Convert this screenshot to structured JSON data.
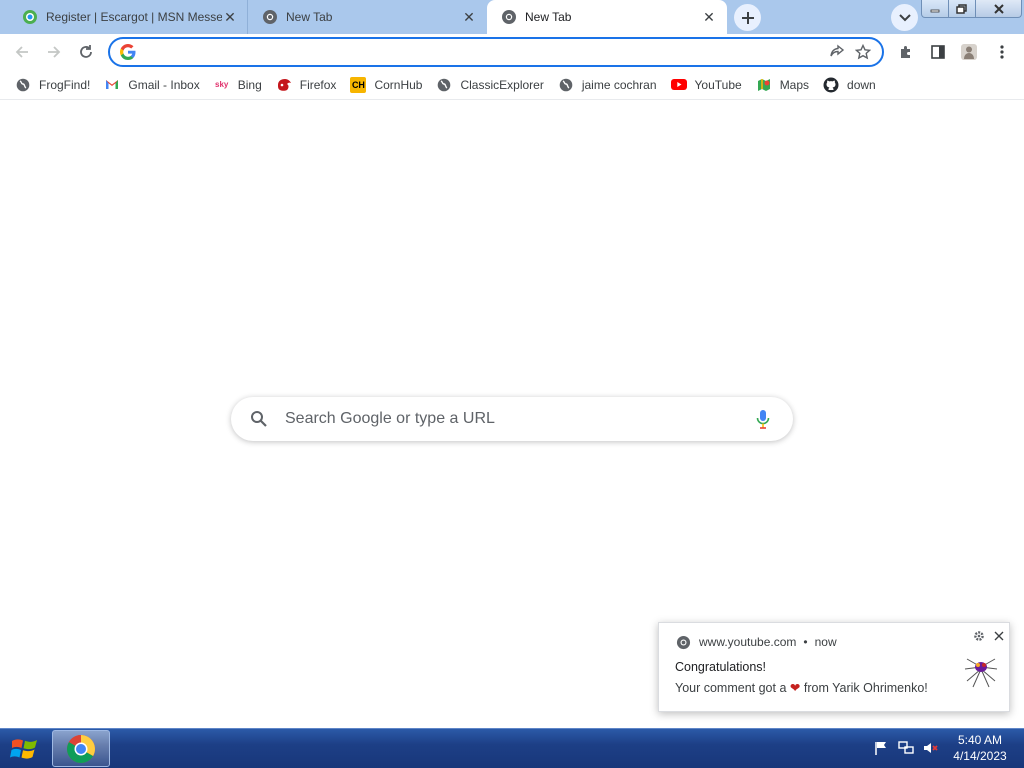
{
  "tabs": [
    {
      "title": "Register | Escargot | MSN Messenger",
      "favicon": "escargot-icon",
      "active": false
    },
    {
      "title": "New Tab",
      "favicon": "chrome-icon",
      "active": false
    },
    {
      "title": "New Tab",
      "favicon": "chrome-icon",
      "active": true
    }
  ],
  "toolbar": {
    "omnibox_value": ""
  },
  "bookmarks": [
    {
      "label": "FrogFind!",
      "icon": "globe-icon"
    },
    {
      "label": "Gmail - Inbox",
      "icon": "gmail-icon"
    },
    {
      "label": "Bing",
      "icon": "sky-icon",
      "icon_text": "sky"
    },
    {
      "label": "Firefox",
      "icon": "firefox-icon"
    },
    {
      "label": "CornHub",
      "icon": "cornhub-icon",
      "icon_text": "CH"
    },
    {
      "label": "ClassicExplorer",
      "icon": "globe-icon"
    },
    {
      "label": "jaime cochran",
      "icon": "globe-icon"
    },
    {
      "label": "YouTube",
      "icon": "youtube-icon"
    },
    {
      "label": "Maps",
      "icon": "maps-icon"
    },
    {
      "label": "down",
      "icon": "github-icon"
    }
  ],
  "search": {
    "placeholder": "Search Google or type a URL"
  },
  "notification": {
    "source": "www.youtube.com",
    "time": "now",
    "title": "Congratulations!",
    "body_prefix": "Your comment got a",
    "body_suffix": "from Yarik Ohrimenko!",
    "heart": "❤"
  },
  "taskbar": {
    "time": "5:40 AM",
    "date": "4/14/2023"
  },
  "colors": {
    "tabstrip": "#aac8ec",
    "accent": "#1a73e8",
    "taskbar": "#1d3f86"
  }
}
